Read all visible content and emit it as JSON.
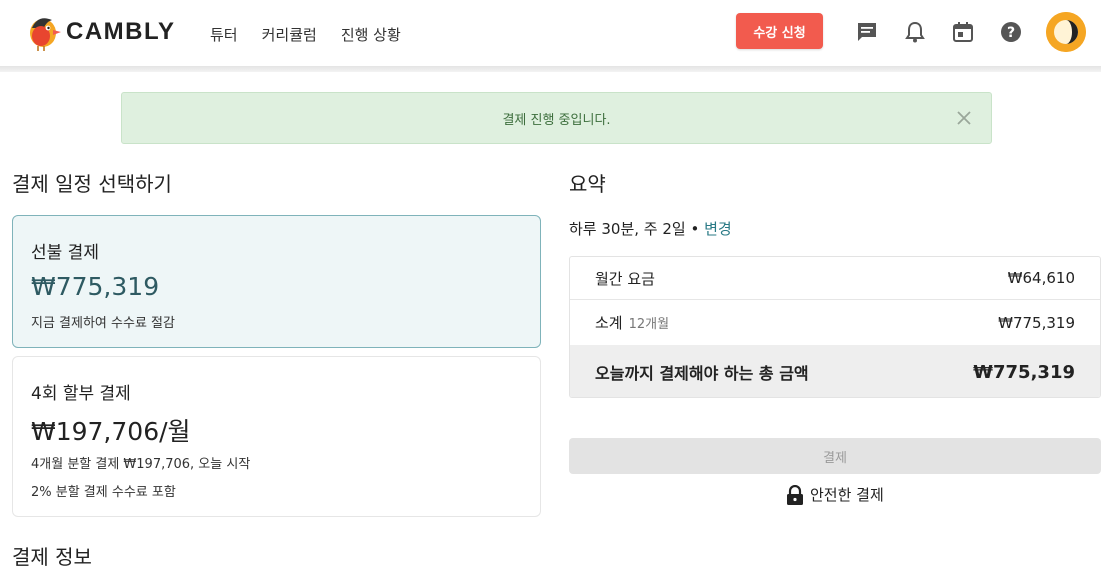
{
  "brand": {
    "name": "CAMBLY",
    "accent": "#f25b4e",
    "teal": "#2a7a86"
  },
  "nav": {
    "items": [
      "튜터",
      "커리큘럼",
      "진행 상황"
    ]
  },
  "header": {
    "cta_label": "수강 신청"
  },
  "icons": {
    "chat": "chat-icon",
    "bell": "bell-icon",
    "calendar": "calendar-icon",
    "help": "help-icon"
  },
  "banner": {
    "message": "결제 진행 중입니다."
  },
  "schedule": {
    "title": "결제 일정 선택하기",
    "plans": [
      {
        "title": "선불 결제",
        "price": "₩775,319",
        "notes": [
          "지금 결제하여 수수료 절감"
        ],
        "selected": true
      },
      {
        "title": "4회 할부 결제",
        "price": "₩197,706/월",
        "notes": [
          "4개월 분할 결제 ₩197,706, 오늘 시작",
          "2% 분할 결제 수수료 포함"
        ],
        "selected": false
      }
    ]
  },
  "payment_info": {
    "title": "결제 정보"
  },
  "summary": {
    "title": "요약",
    "frequency": "하루 30분, 주 2일",
    "separator": "•",
    "change_label": "변경",
    "monthly_label": "월간 요금",
    "monthly_value": "₩64,610",
    "subtotal_label": "소계",
    "subtotal_period": "12개월",
    "subtotal_value": "₩775,319",
    "total_label": "오늘까지 결제해야 하는 총 금액",
    "total_value": "₩775,319"
  },
  "pay": {
    "button_label": "결제",
    "secure_label": "안전한 결제"
  }
}
